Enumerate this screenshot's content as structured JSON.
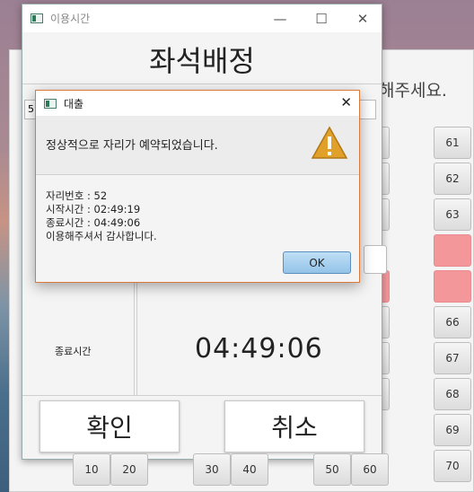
{
  "background_window": {
    "hint_text": "해주세요.",
    "seat_column_right": [
      {
        "label": "61",
        "state": "normal"
      },
      {
        "label": "62",
        "state": "normal"
      },
      {
        "label": "63",
        "state": "normal"
      },
      {
        "label": "",
        "state": "reserved"
      },
      {
        "label": "",
        "state": "reserved"
      },
      {
        "label": "66",
        "state": "normal"
      },
      {
        "label": "67",
        "state": "normal"
      },
      {
        "label": "68",
        "state": "normal"
      },
      {
        "label": "69",
        "state": "normal"
      },
      {
        "label": "70",
        "state": "normal"
      }
    ],
    "bottom_row": [
      "10",
      "20",
      "30",
      "40",
      "50",
      "60"
    ]
  },
  "time_window": {
    "title": "이용시간",
    "heading": "좌석배정",
    "seat_field_partial": "5",
    "end_time_label": "종료시간",
    "end_time_value": "04:49:06",
    "confirm_label": "확인",
    "cancel_label": "취소"
  },
  "dialog": {
    "title": "대출",
    "message": "정상적으로 자리가 예약되었습니다.",
    "details": [
      "자리번호 : 52",
      "시작시간 : 02:49:19",
      "종료시간 : 04:49:06",
      "이용해주셔서 감사합니다."
    ],
    "ok_label": "OK",
    "icon": "warning-icon"
  },
  "colors": {
    "reserved_seat": "#f4979b",
    "dialog_border": "#d97a3c",
    "warning_triangle": "#e0a02a",
    "ok_button": "#a9d2f0"
  }
}
